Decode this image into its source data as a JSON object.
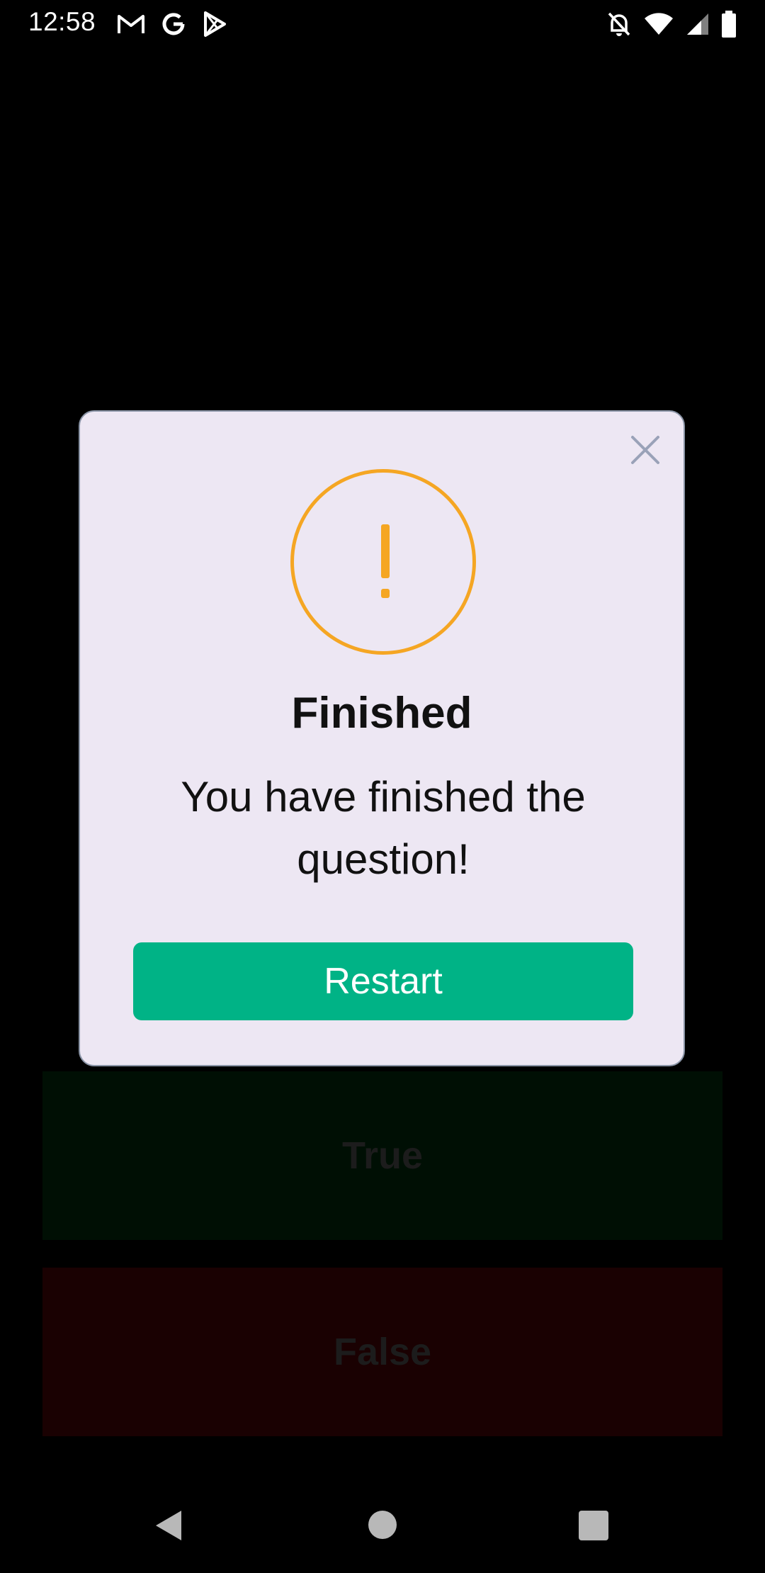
{
  "status_bar": {
    "time": "12:58",
    "left_icons": [
      "gmail-icon",
      "google-icon",
      "play-store-icon"
    ],
    "right_icons": [
      "notifications-off-icon",
      "wifi-icon",
      "signal-icon",
      "battery-icon"
    ]
  },
  "answers": {
    "true_label": "True",
    "false_label": "False"
  },
  "dialog": {
    "icon": "warning-icon",
    "title": "Finished",
    "message": "You have finished the question!",
    "button_label": "Restart",
    "close_icon": "close-icon"
  },
  "colors": {
    "accent_warning": "#f5a623",
    "button_green": "#00b386",
    "dialog_bg": "#ede7f3"
  },
  "nav_bar": {
    "buttons": [
      "back-icon",
      "home-icon",
      "recents-icon"
    ]
  }
}
